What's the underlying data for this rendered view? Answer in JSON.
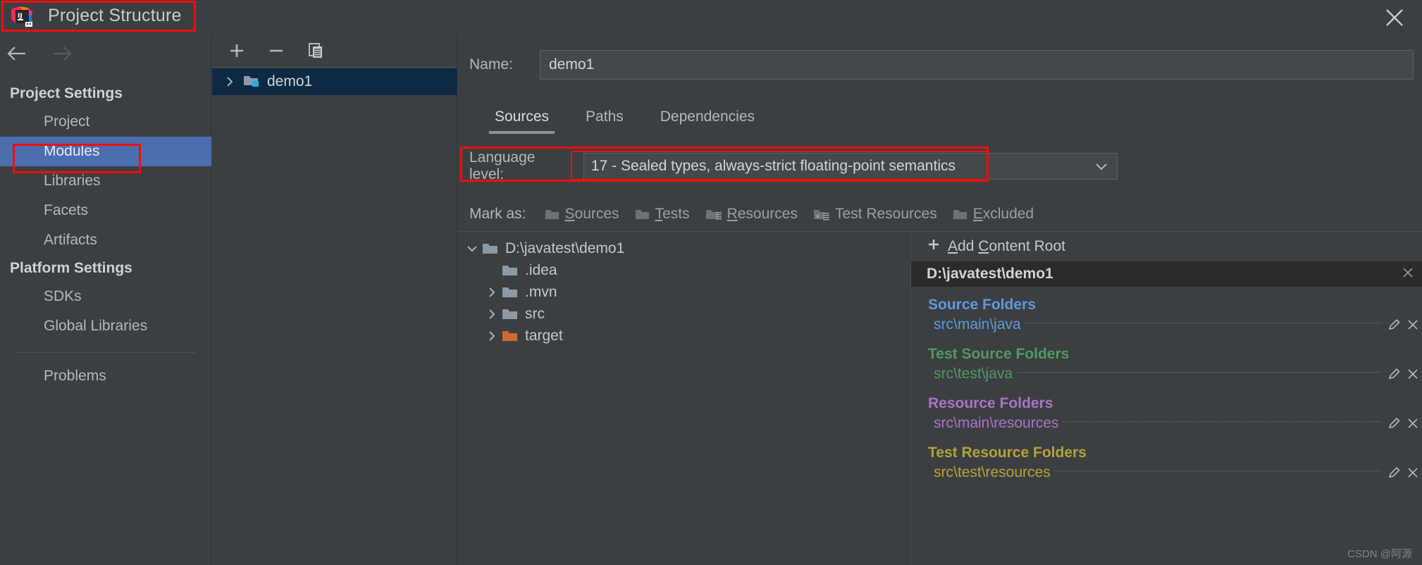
{
  "window": {
    "title": "Project Structure",
    "logo_icon": "intellij-idea-logo",
    "close_icon": "close-icon",
    "back_icon": "back-arrow-icon",
    "forward_icon": "forward-arrow-icon"
  },
  "sidebar": {
    "groups": [
      {
        "label": "Project Settings",
        "items": [
          {
            "label": "Project",
            "selected": false
          },
          {
            "label": "Modules",
            "selected": true
          },
          {
            "label": "Libraries",
            "selected": false
          },
          {
            "label": "Facets",
            "selected": false
          },
          {
            "label": "Artifacts",
            "selected": false
          }
        ]
      },
      {
        "label": "Platform Settings",
        "items": [
          {
            "label": "SDKs",
            "selected": false
          },
          {
            "label": "Global Libraries",
            "selected": false
          }
        ]
      }
    ],
    "footer_items": [
      {
        "label": "Problems",
        "selected": false
      }
    ]
  },
  "modules": {
    "toolbar": [
      {
        "name": "add-module-button",
        "icon": "plus-icon"
      },
      {
        "name": "remove-module-button",
        "icon": "minus-icon"
      },
      {
        "name": "copy-module-button",
        "icon": "copy-icon"
      }
    ],
    "tree": [
      {
        "label": "demo1",
        "icon": "module-folder-icon",
        "expanded": false,
        "selected": true
      }
    ]
  },
  "main": {
    "name_label": "Name:",
    "name_value": "demo1",
    "tabs": [
      {
        "label": "Sources",
        "active": true
      },
      {
        "label": "Paths",
        "active": false
      },
      {
        "label": "Dependencies",
        "active": false
      }
    ],
    "language_level": {
      "label": "Language level:",
      "value": "17 - Sealed types, always-strict floating-point semantics",
      "dropdown_icon": "chevron-down-icon"
    },
    "mark_as": {
      "label": "Mark as:",
      "buttons": [
        {
          "label": "Sources",
          "mnemonic": "S",
          "icon": "sources-folder-icon"
        },
        {
          "label": "Tests",
          "mnemonic": "T",
          "icon": "tests-folder-icon"
        },
        {
          "label": "Resources",
          "mnemonic": "R",
          "icon": "resources-folder-icon"
        },
        {
          "label": "Test Resources",
          "mnemonic": "",
          "icon": "test-resources-folder-icon"
        },
        {
          "label": "Excluded",
          "mnemonic": "E",
          "icon": "excluded-folder-icon"
        }
      ]
    },
    "file_tree": [
      {
        "label": "D:\\javatest\\demo1",
        "depth": 0,
        "expandable": true,
        "expanded": true,
        "icon": "folder-icon",
        "color": "#c5c8ca"
      },
      {
        "label": ".idea",
        "depth": 1,
        "expandable": false,
        "expanded": false,
        "icon": "folder-icon",
        "color": "#c5c8ca"
      },
      {
        "label": ".mvn",
        "depth": 1,
        "expandable": true,
        "expanded": false,
        "icon": "folder-icon",
        "color": "#c5c8ca"
      },
      {
        "label": "src",
        "depth": 1,
        "expandable": true,
        "expanded": false,
        "icon": "folder-icon",
        "color": "#c5c8ca"
      },
      {
        "label": "target",
        "depth": 1,
        "expandable": true,
        "expanded": false,
        "icon": "excluded-folder-icon",
        "color": "#c5c8ca"
      }
    ],
    "content_roots": {
      "add_label": "Add Content Root",
      "add_icon": "plus-icon",
      "root_path": "D:\\javatest\\demo1",
      "close_icon": "close-icon",
      "edit_icon": "pencil-icon",
      "categories": [
        {
          "title": "Source Folders",
          "color": "#5c9ade",
          "paths": [
            {
              "path": "src\\main\\java",
              "color": "#5c9ade"
            }
          ]
        },
        {
          "title": "Test Source Folders",
          "color": "#4f9a63",
          "paths": [
            {
              "path": "src\\test\\java",
              "color": "#4f9a63"
            }
          ]
        },
        {
          "title": "Resource Folders",
          "color": "#a874c7",
          "paths": [
            {
              "path": "src\\main\\resources",
              "color": "#a874c7"
            }
          ]
        },
        {
          "title": "Test Resource Folders",
          "color": "#b3a33a",
          "paths": [
            {
              "path": "src\\test\\resources",
              "color": "#b3a33a"
            }
          ]
        }
      ]
    }
  },
  "watermark": "CSDN @阿源",
  "colors": {
    "accent_selection": "#4b6eaf",
    "annotation_red": "#f20d0d",
    "background": "#3c3f41",
    "row_selected": "#0d2a42"
  }
}
